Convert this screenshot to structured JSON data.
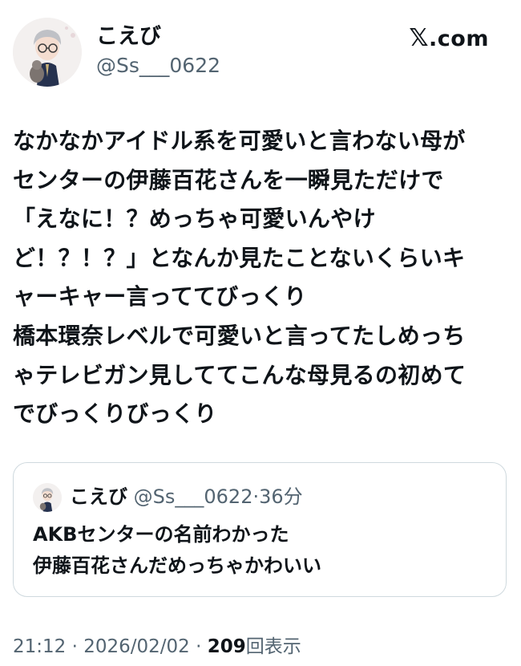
{
  "site": "X.com",
  "author": {
    "display_name": "こえび",
    "handle": "@Ss___0622"
  },
  "tweet": {
    "lines": [
      "なかなかアイドル系を可愛いと言わない母が",
      "センターの伊藤百花さんを一瞬見ただけで",
      "「えなに！？めっちゃ可愛いんやけ",
      "ど！？！？」となんか見たことないくらいキ",
      "ャーキャー言っててびっくり",
      "橋本環奈レベルで可愛いと言ってたしめっち",
      "ゃテレビガン見しててこんな母見るの初めて",
      "でびっくりびっくり"
    ]
  },
  "quoted": {
    "display_name": "こえび",
    "handle": "@Ss___0622",
    "separator": "·",
    "time": "36分",
    "lines": [
      "AKBセンターの名前わかった",
      "伊藤百花さんだめっちゃかわいい"
    ]
  },
  "footer": {
    "time": "21:12",
    "separator": " · ",
    "date": "2026/02/02",
    "views_count": "209",
    "views_label": "回表示"
  },
  "colors": {
    "text": "#0f1419",
    "muted": "#536471",
    "border": "#cfd9de"
  },
  "icons": [
    "avatar-illustration",
    "x-logo"
  ]
}
